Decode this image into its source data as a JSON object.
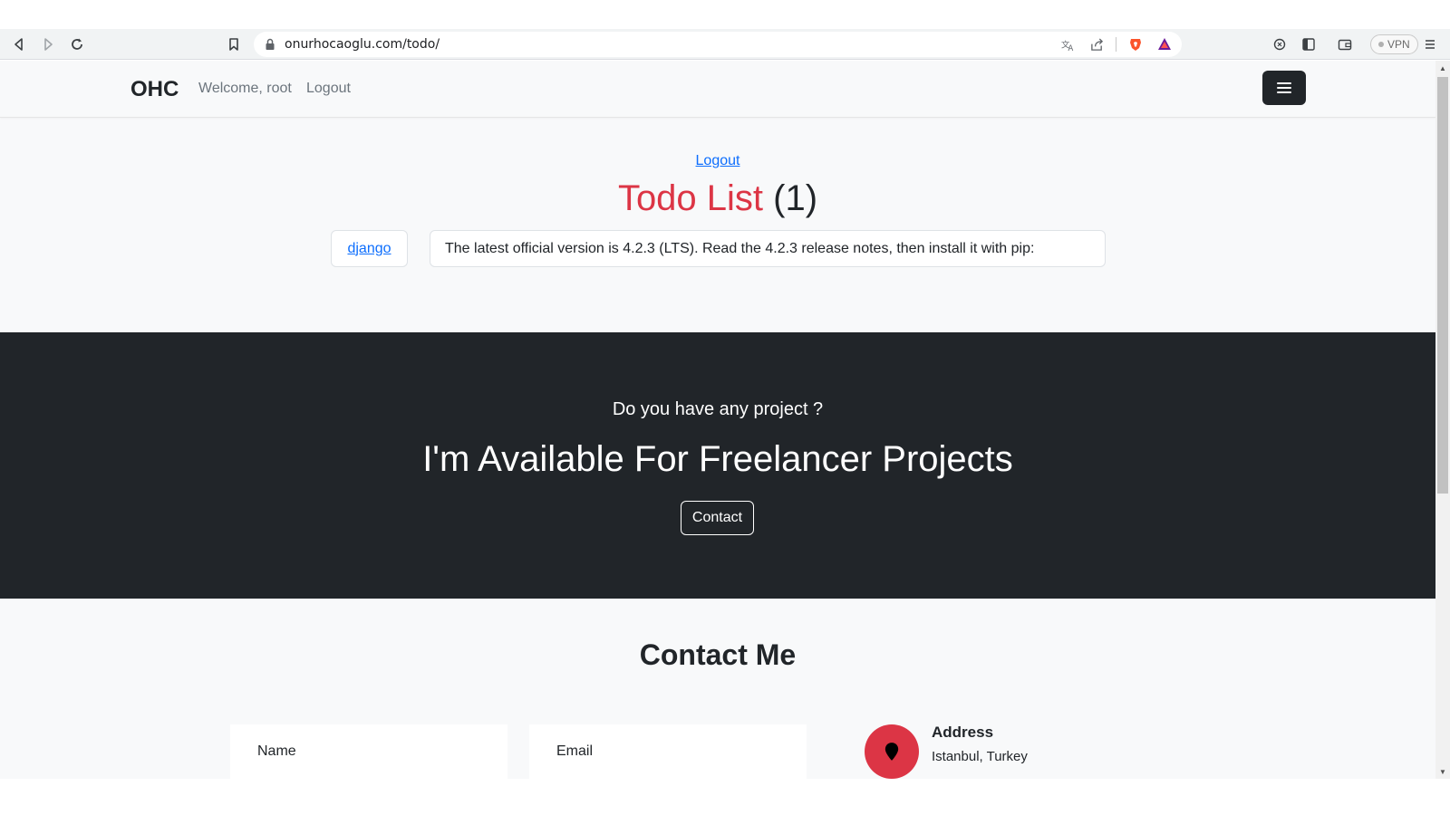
{
  "browser": {
    "url": "onurhocaoglu.com/todo/",
    "vpn_label": "VPN"
  },
  "navbar": {
    "brand": "OHC",
    "welcome": "Welcome, root",
    "logout": "Logout"
  },
  "todo": {
    "logout_link": "Logout",
    "title": "Todo List",
    "count": "(1)",
    "items": [
      {
        "tag": "django",
        "description": "The latest official version is 4.2.3 (LTS). Read the 4.2.3 release notes, then install it with pip:"
      }
    ]
  },
  "banner": {
    "subtitle": "Do you have any project ?",
    "title": "I'm Available For Freelancer Projects",
    "button": "Contact"
  },
  "contact": {
    "title": "Contact Me",
    "name_placeholder": "Name",
    "email_placeholder": "Email",
    "address_label": "Address",
    "address_value": "Istanbul, Turkey"
  },
  "colors": {
    "accent_red": "#dc3545",
    "dark": "#212529",
    "link_blue": "#0d6efd"
  },
  "icons": {
    "back": "back-arrow-icon",
    "forward": "forward-arrow-icon",
    "reload": "reload-icon",
    "bookmark": "bookmark-icon",
    "lock": "lock-icon",
    "translate": "translate-icon",
    "share": "share-icon",
    "brave": "brave-shield-icon",
    "rewards": "brave-rewards-icon",
    "menu": "hamburger-menu-icon",
    "location": "map-pin-icon"
  }
}
